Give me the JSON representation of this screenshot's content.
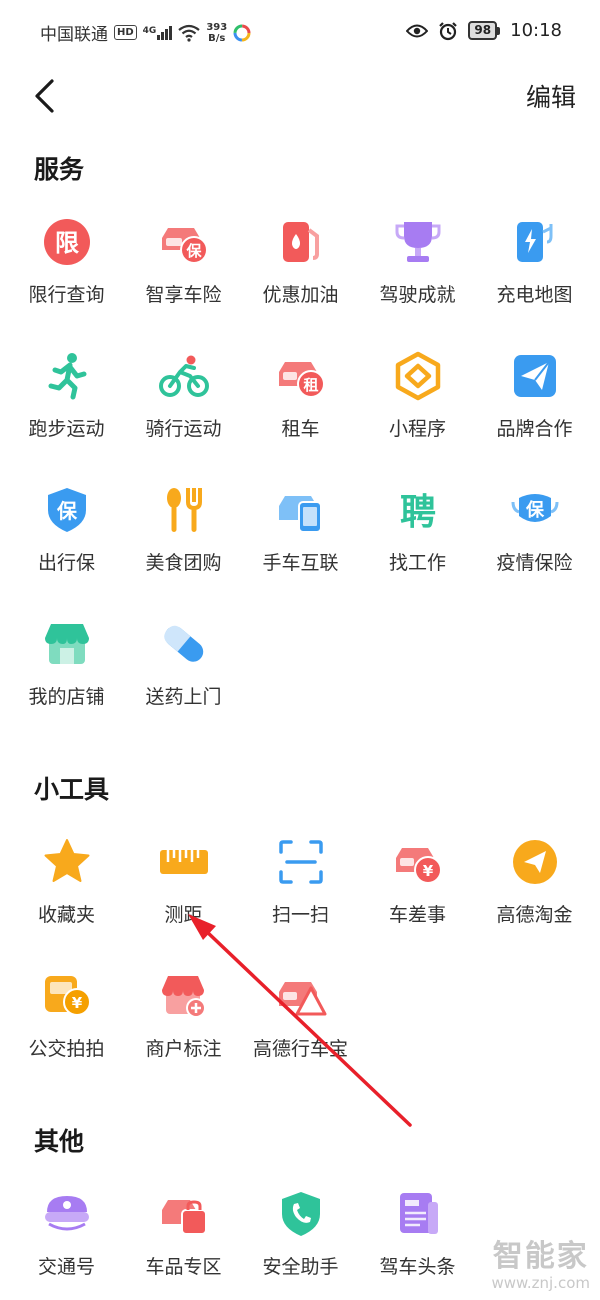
{
  "status_bar": {
    "carrier": "中国联通",
    "hd": "HD",
    "signal": "4G",
    "net_speed_value": "393",
    "net_speed_unit": "B/s",
    "battery": "98",
    "time": "10:18"
  },
  "nav": {
    "back_icon": "chevron-left-icon",
    "edit_label": "编辑"
  },
  "sections": {
    "services": {
      "title": "服务",
      "items": [
        {
          "label": "限行查询",
          "icon": "restriction-icon"
        },
        {
          "label": "智享车险",
          "icon": "car-insurance-icon"
        },
        {
          "label": "优惠加油",
          "icon": "fuel-pump-icon"
        },
        {
          "label": "驾驶成就",
          "icon": "trophy-icon"
        },
        {
          "label": "充电地图",
          "icon": "charging-station-icon"
        },
        {
          "label": "跑步运动",
          "icon": "running-person-icon"
        },
        {
          "label": "骑行运动",
          "icon": "cycling-icon"
        },
        {
          "label": "租车",
          "icon": "car-rental-icon"
        },
        {
          "label": "小程序",
          "icon": "mini-program-icon"
        },
        {
          "label": "品牌合作",
          "icon": "paper-plane-icon"
        },
        {
          "label": "出行保",
          "icon": "shield-insurance-icon"
        },
        {
          "label": "美食团购",
          "icon": "spoon-fork-icon"
        },
        {
          "label": "手车互联",
          "icon": "phone-car-icon"
        },
        {
          "label": "找工作",
          "icon": "job-icon"
        },
        {
          "label": "疫情保险",
          "icon": "mask-insurance-icon"
        },
        {
          "label": "我的店铺",
          "icon": "shop-icon"
        },
        {
          "label": "送药上门",
          "icon": "pill-icon"
        }
      ]
    },
    "tools": {
      "title": "小工具",
      "items": [
        {
          "label": "收藏夹",
          "icon": "star-icon"
        },
        {
          "label": "测距",
          "icon": "ruler-icon"
        },
        {
          "label": "扫一扫",
          "icon": "scan-icon"
        },
        {
          "label": "车差事",
          "icon": "car-yuan-icon"
        },
        {
          "label": "高德淘金",
          "icon": "send-circle-icon"
        },
        {
          "label": "公交拍拍",
          "icon": "bus-yuan-icon"
        },
        {
          "label": "商户标注",
          "icon": "shop-plus-icon"
        },
        {
          "label": "高德行车宝",
          "icon": "car-warning-icon"
        }
      ]
    },
    "other": {
      "title": "其他",
      "items": [
        {
          "label": "交通号",
          "icon": "police-cap-icon"
        },
        {
          "label": "车品专区",
          "icon": "car-bag-icon"
        },
        {
          "label": "安全助手",
          "icon": "shield-phone-icon"
        },
        {
          "label": "驾车头条",
          "icon": "news-icon"
        }
      ]
    }
  },
  "watermark": {
    "name": "智能家",
    "url": "www.znj.com"
  },
  "colors": {
    "red": "#f25a5a",
    "orange": "#f8a91c",
    "blue": "#3a9bf0",
    "green": "#2fc39a",
    "purple": "#a77cf2",
    "arrow": "#e8202a"
  }
}
